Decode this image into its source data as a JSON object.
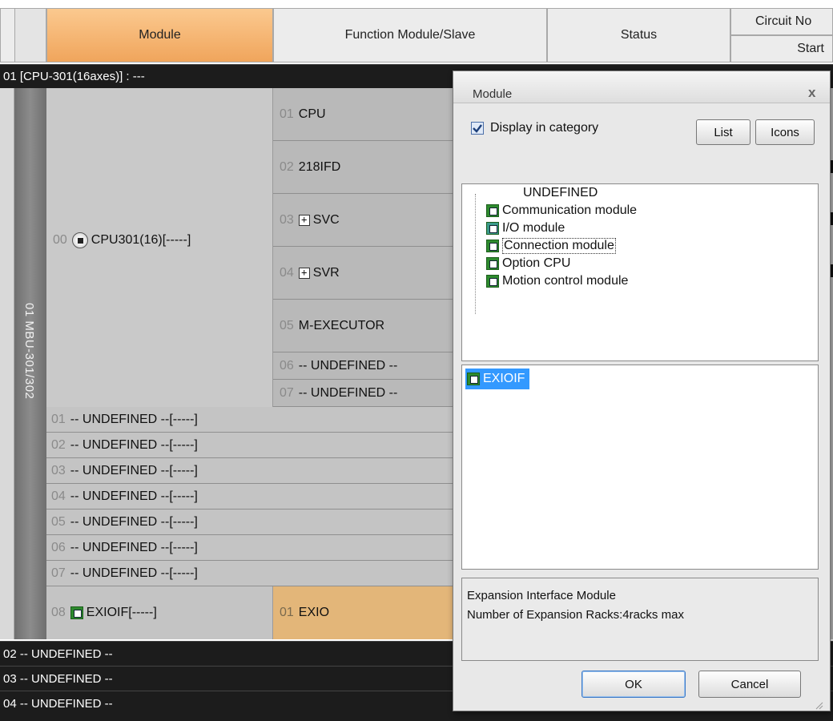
{
  "header": {
    "module": "Module",
    "function_module": "Function Module/Slave",
    "status": "Status",
    "circuit_no": "Circuit No",
    "start": "Start"
  },
  "rack01_title": "01 [CPU-301(16axes)] : ---",
  "rack_label": "01 MBU-301/302",
  "cpu_slot": {
    "num": "00",
    "label": "CPU301(16)[-----]"
  },
  "functions": [
    {
      "num": "01",
      "label": "CPU"
    },
    {
      "num": "02",
      "label": "218IFD"
    },
    {
      "num": "03",
      "label": "SVC",
      "expand": "+"
    },
    {
      "num": "04",
      "label": "SVR",
      "expand": "+"
    },
    {
      "num": "05",
      "label": "M-EXECUTOR"
    },
    {
      "num": "06",
      "label": "-- UNDEFINED --"
    },
    {
      "num": "07",
      "label": "-- UNDEFINED --"
    }
  ],
  "slots": [
    {
      "num": "01",
      "label": "-- UNDEFINED --[-----]"
    },
    {
      "num": "02",
      "label": "-- UNDEFINED --[-----]"
    },
    {
      "num": "03",
      "label": "-- UNDEFINED --[-----]"
    },
    {
      "num": "04",
      "label": "-- UNDEFINED --[-----]"
    },
    {
      "num": "05",
      "label": "-- UNDEFINED --[-----]"
    },
    {
      "num": "06",
      "label": "-- UNDEFINED --[-----]"
    },
    {
      "num": "07",
      "label": "-- UNDEFINED --[-----]"
    }
  ],
  "exio_slot": {
    "num": "08",
    "label": "EXIOIF[-----]",
    "fn_num": "01",
    "fn_label": "EXIO"
  },
  "racks": [
    "02 -- UNDEFINED --",
    "03 -- UNDEFINED --",
    "04 -- UNDEFINED --"
  ],
  "dialog": {
    "title": "Module",
    "close": "x",
    "display_in_category": "Display in category",
    "list_btn": "List",
    "icons_btn": "Icons",
    "tree": [
      {
        "label": "UNDEFINED",
        "icon": "none-icon"
      },
      {
        "label": "Communication module",
        "icon": "communication-module-icon"
      },
      {
        "label": "I/O module",
        "icon": "io-module-icon"
      },
      {
        "label": "Connection module",
        "icon": "connection-module-icon",
        "focused": true
      },
      {
        "label": "Option CPU",
        "icon": "option-cpu-icon"
      },
      {
        "label": "Motion control module",
        "icon": "motion-control-module-icon"
      }
    ],
    "selected_item": "EXIOIF",
    "description_line1": "Expansion Interface Module",
    "description_line2": "Number of Expansion Racks:4racks max",
    "ok": "OK",
    "cancel": "Cancel"
  },
  "colors": {
    "module_header": "#f0a55c",
    "exio_fn_cell": "#e3b679",
    "selection": "#3399ff",
    "dark_bar": "#1c1c1c"
  }
}
